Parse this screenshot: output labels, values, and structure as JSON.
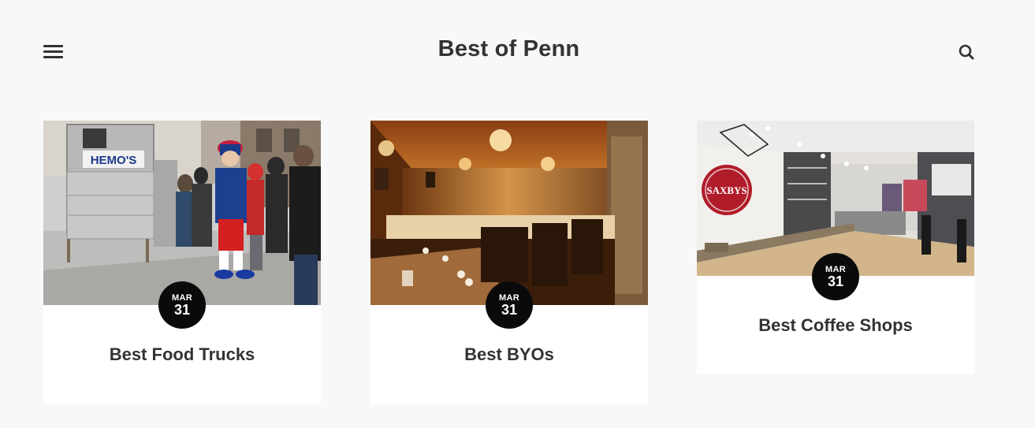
{
  "header": {
    "title": "Best of Penn",
    "menu_icon": "hamburger-menu-icon",
    "search_icon": "search-icon"
  },
  "cards": [
    {
      "title": "Best Food Trucks",
      "month": "MAR",
      "day": "31",
      "image_text": "HEMO'S"
    },
    {
      "title": "Best BYOs",
      "month": "MAR",
      "day": "31"
    },
    {
      "title": "Best Coffee Shops",
      "month": "MAR",
      "day": "31",
      "image_text": "SAXBYS"
    }
  ],
  "colors": {
    "background": "#f8f8f8",
    "card": "#ffffff",
    "text": "#333333",
    "badge": "#0a0a0a"
  }
}
